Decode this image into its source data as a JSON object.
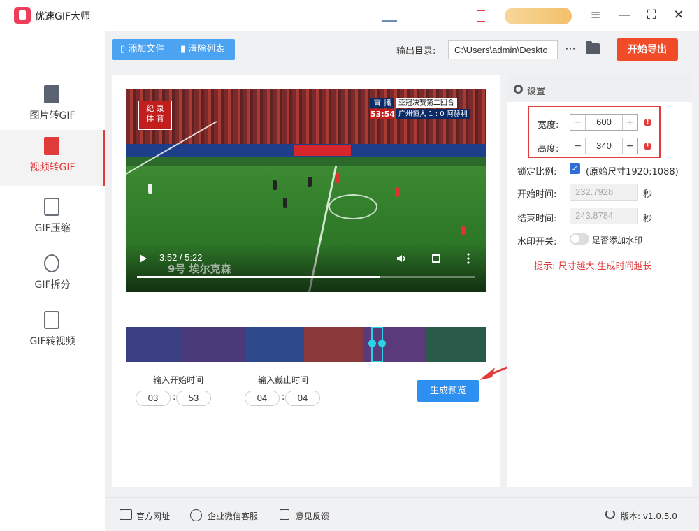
{
  "app": {
    "title": "优速GIF大师"
  },
  "window": {
    "minimize": "—",
    "maximize": "⛶",
    "close": "✕",
    "menu": "≡"
  },
  "sidebar": {
    "items": [
      {
        "label": "图片转GIF",
        "icon": "image-file-icon"
      },
      {
        "label": "视频转GIF",
        "icon": "video-file-icon",
        "active": true
      },
      {
        "label": "GIF压缩",
        "icon": "compress-icon"
      },
      {
        "label": "GIF拆分",
        "icon": "split-icon"
      },
      {
        "label": "GIF转视频",
        "icon": "gif-file-icon"
      }
    ]
  },
  "toolbar": {
    "add_file": "添加文件",
    "clear_list": "清除列表",
    "output_label": "输出目录:",
    "output_path": "C:\\Users\\admin\\Deskto",
    "more": "···",
    "export": "开始导出"
  },
  "video": {
    "time": "3:52 / 5:22",
    "subtitle": "9号  埃尔克森",
    "progress": 0.72,
    "logo_text": "纪 录\n体 育",
    "live_badge": "直 播",
    "live_timer": "53:54",
    "match_title": "亚冠决赛第二回合",
    "match_score": "广州恒大 1 : 0 阿赫利"
  },
  "trim": {
    "start_label": "输入开始时间",
    "end_label": "输入截止时间",
    "start_min": "03",
    "start_sec": "53",
    "end_min": "04",
    "end_sec": "04",
    "colon": ":",
    "preview_button": "生成预览"
  },
  "settings": {
    "title": "设置",
    "width_label": "宽度:",
    "width_value": "600",
    "height_label": "高度:",
    "height_value": "340",
    "lock_label": "锁定比例:",
    "lock_checked": true,
    "original_size": "(原始尺寸1920:1088)",
    "start_label": "开始时间:",
    "start_value": "232.7928",
    "end_label": "结束时间:",
    "end_value": "243.8784",
    "sec_unit": "秒",
    "watermark_label": "水印开关:",
    "watermark_text": "是否添加水印",
    "watermark_on": false,
    "hint": "提示: 尺寸越大,生成时间越长",
    "minus": "−",
    "plus": "+",
    "warn": "!"
  },
  "footer": {
    "website": "官方网址",
    "wechat": "企业微信客服",
    "feedback": "意见反馈",
    "version": "版本: v1.0.5.0"
  },
  "colors": {
    "accent_red": "#e23b3b",
    "export_orange": "#f24b27",
    "blue": "#2d8ff0",
    "toolbar_blue": "#4ba3f1"
  }
}
